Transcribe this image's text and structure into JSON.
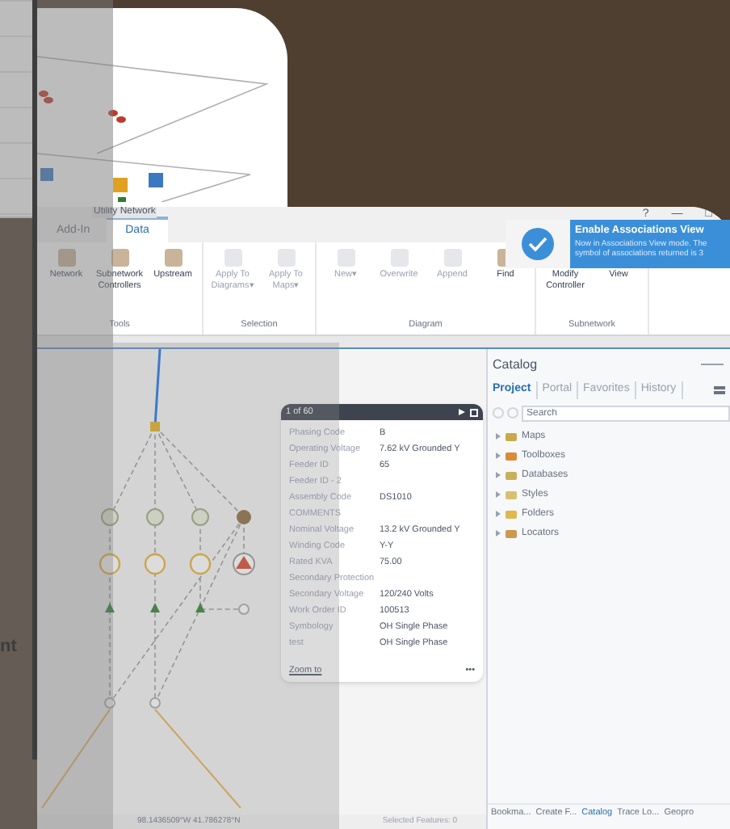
{
  "side_card": {
    "caption": "nt"
  },
  "ribbon": {
    "context_label": "Utility Network",
    "tabs": [
      {
        "label": "Add-In",
        "selected": false
      },
      {
        "label": "Data",
        "selected": true
      }
    ],
    "window_controls": [
      "?",
      "—",
      "□"
    ],
    "groups": [
      {
        "label": "Tools",
        "buttons": [
          {
            "label": "Network",
            "disabled": false
          },
          {
            "label": "Subnetwork Controllers",
            "disabled": false
          },
          {
            "label": "Upstream",
            "disabled": false
          }
        ]
      },
      {
        "label": "Selection",
        "buttons": [
          {
            "label": "Apply To Diagrams▾",
            "disabled": true
          },
          {
            "label": "Apply To Maps▾",
            "disabled": true
          }
        ]
      },
      {
        "label": "Diagram",
        "buttons": [
          {
            "label": "New▾",
            "disabled": true
          },
          {
            "label": "Overwrite",
            "disabled": true
          },
          {
            "label": "Append",
            "disabled": true
          },
          {
            "label": "Find",
            "disabled": false
          }
        ]
      },
      {
        "label": "Subnetwork",
        "buttons": [
          {
            "label": "Modify Controller",
            "disabled": false
          },
          {
            "label": "View",
            "disabled": false
          }
        ]
      }
    ]
  },
  "toast": {
    "title": "Enable Associations View",
    "message": "Now in Associations View mode. The symbol of associations returned is 3"
  },
  "map": {
    "popup": {
      "header": "1 of 60",
      "fields": [
        {
          "name": "Phasing Code",
          "value": "B"
        },
        {
          "name": "Operating Voltage",
          "value": "7.62 kV Grounded Y"
        },
        {
          "name": "Feeder ID",
          "value": "65"
        },
        {
          "name": "Feeder ID - 2"
        },
        {
          "name": "Assembly Code",
          "value": "DS1010"
        },
        {
          "name": "COMMENTS"
        },
        {
          "name": "Nominal Voltage",
          "value": "13.2 kV Grounded Y"
        },
        {
          "name": "Winding Code",
          "value": "Y-Y"
        },
        {
          "name": "Rated KVA",
          "value": "75.00"
        },
        {
          "name": "Secondary Protection"
        },
        {
          "name": "Secondary Voltage",
          "value": "120/240 Volts"
        },
        {
          "name": "Work Order ID",
          "value": "100513"
        },
        {
          "name": "Symbology",
          "value": "OH Single Phase"
        },
        {
          "name": "test",
          "value": "OH Single Phase"
        }
      ],
      "link": "Zoom to",
      "more": "•••"
    },
    "coordinates": "98.1436509°W 41.786278°N",
    "selected_features": "Selected Features: 0"
  },
  "catalog": {
    "title": "Catalog",
    "tabs": [
      {
        "label": "Project",
        "selected": true
      },
      {
        "label": "Portal",
        "selected": false
      },
      {
        "label": "Favorites",
        "selected": false
      },
      {
        "label": "History",
        "selected": false
      }
    ],
    "search": {
      "placeholder": "Search"
    },
    "items": [
      "Maps",
      "Toolboxes",
      "Databases",
      "Styles",
      "Folders",
      "Locators"
    ],
    "bottom_tabs": [
      {
        "label": "Bookma...",
        "selected": false
      },
      {
        "label": "Create F...",
        "selected": false
      },
      {
        "label": "Catalog",
        "selected": true
      },
      {
        "label": "Trace Lo...",
        "selected": false
      },
      {
        "label": "Geopro",
        "selected": false
      }
    ]
  }
}
